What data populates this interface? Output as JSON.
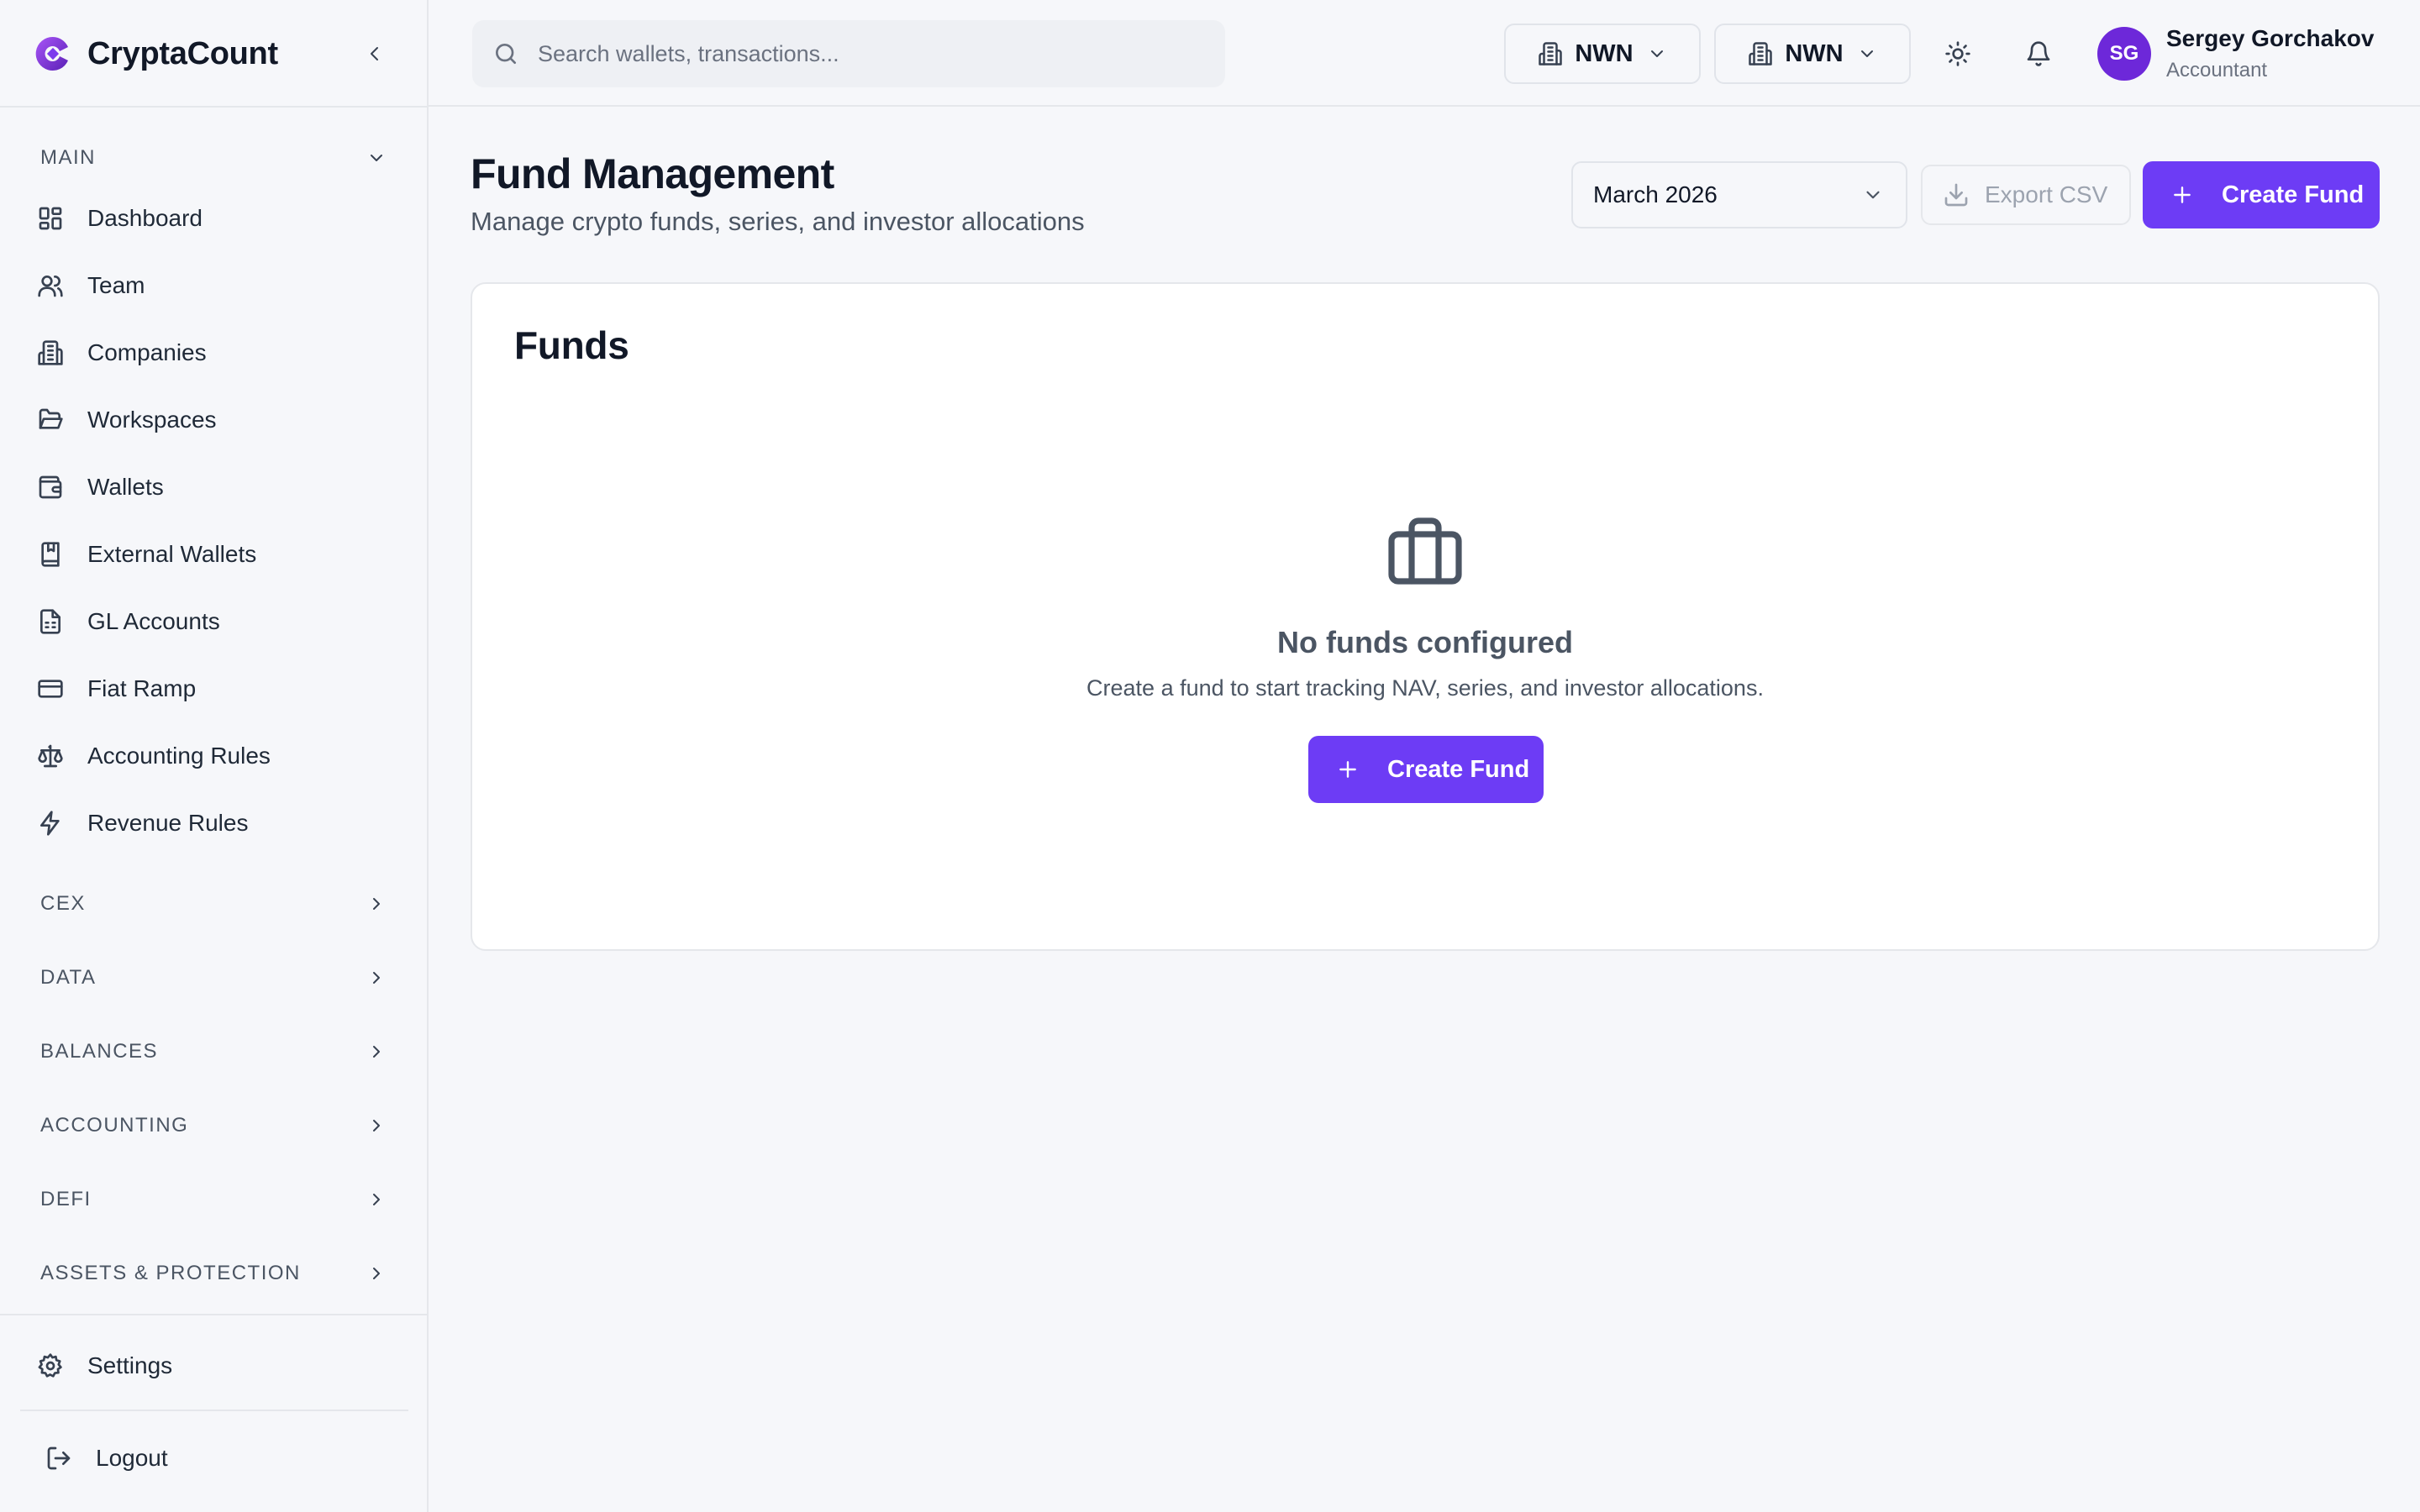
{
  "app": {
    "name": "CryptaCount"
  },
  "colors": {
    "accent": "#6d3cf5",
    "avatar_bg": "#6d28d9"
  },
  "search": {
    "placeholder": "Search wallets, transactions..."
  },
  "header": {
    "org_selectors": [
      {
        "label": "NWN",
        "icon": "building-icon"
      },
      {
        "label": "NWN",
        "icon": "building-icon"
      }
    ],
    "icons": [
      "sun-icon",
      "bell-icon"
    ],
    "user": {
      "initials": "SG",
      "name": "Sergey Gorchakov",
      "role": "Accountant"
    }
  },
  "sidebar": {
    "main_section": "MAIN",
    "items": [
      {
        "label": "Dashboard",
        "icon": "dashboard-icon"
      },
      {
        "label": "Team",
        "icon": "team-icon"
      },
      {
        "label": "Companies",
        "icon": "building-icon"
      },
      {
        "label": "Workspaces",
        "icon": "folder-icon"
      },
      {
        "label": "Wallets",
        "icon": "wallet-icon"
      },
      {
        "label": "External Wallets",
        "icon": "book-icon"
      },
      {
        "label": "GL Accounts",
        "icon": "file-icon"
      },
      {
        "label": "Fiat Ramp",
        "icon": "card-icon"
      },
      {
        "label": "Accounting Rules",
        "icon": "scale-icon"
      },
      {
        "label": "Revenue Rules",
        "icon": "bolt-icon"
      }
    ],
    "sections": [
      "CEX",
      "DATA",
      "BALANCES",
      "ACCOUNTING",
      "DEFI",
      "ASSETS & PROTECTION"
    ],
    "settings_label": "Settings",
    "logout_label": "Logout"
  },
  "page": {
    "title": "Fund Management",
    "subtitle": "Manage crypto funds, series, and investor allocations",
    "month": "March 2026",
    "export_label": "Export CSV",
    "create_label": "Create Fund"
  },
  "card": {
    "title": "Funds",
    "empty_icon": "briefcase-icon",
    "empty_title": "No funds configured",
    "empty_description": "Create a fund to start tracking NAV, series, and investor allocations.",
    "create_label": "Create Fund"
  }
}
